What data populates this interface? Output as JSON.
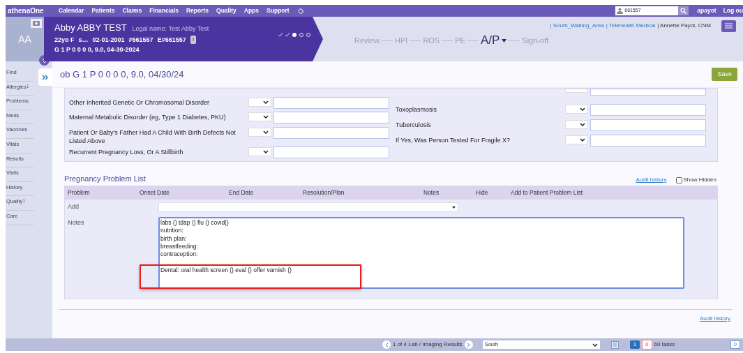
{
  "nav": {
    "brand": "athenaOne",
    "items": [
      "Calendar",
      "Patients",
      "Claims",
      "Financials",
      "Reports",
      "Quality",
      "Apps",
      "Support"
    ],
    "search_value": "661557",
    "user": "apayot",
    "logout": "Log ou"
  },
  "patient": {
    "initials": "AA",
    "name": "Abby ABBY TEST",
    "legal_name": "Legal name: Test Abby Test",
    "details": [
      "22yo F",
      "s…",
      "02-01-2001",
      "#661557",
      "E#661557"
    ],
    "alert": "!",
    "ob_line": "G 1 P 0 0 0 0, 9.0, 04-30-2024",
    "steps": [
      {
        "kind": "done"
      },
      {
        "kind": "done"
      },
      {
        "kind": "current"
      },
      {
        "kind": "todo"
      },
      {
        "kind": "todo"
      }
    ]
  },
  "location": {
    "links": [
      "| South_Waiting_Area",
      "| Telehealth Medical"
    ],
    "provider": "| Annette Payot, CNM"
  },
  "workflow": [
    {
      "label": "Review",
      "selected": false
    },
    {
      "label": "HPI",
      "selected": false
    },
    {
      "label": "ROS",
      "selected": false
    },
    {
      "label": "PE",
      "selected": false
    },
    {
      "label": "A/P",
      "selected": true
    },
    {
      "label": "Sign-off",
      "selected": false
    }
  ],
  "sidebar": [
    {
      "label": "Find"
    },
    {
      "label": "Allergies",
      "badge": "1"
    },
    {
      "label": "Problems"
    },
    {
      "label": "Meds"
    },
    {
      "label": "Vaccines"
    },
    {
      "label": "Vitals"
    },
    {
      "label": "Results"
    },
    {
      "label": "Visits"
    },
    {
      "label": "History"
    },
    {
      "label": "Quality",
      "badge": "1"
    },
    {
      "label": "Care"
    }
  ],
  "page_title": "ob G 1 P 0 0 0 0, 9.0, 04/30/24",
  "save": "Save",
  "questions_left": [
    "Other Inherited Genetic Or Chromosomal Disorder",
    "Maternal Metabolic Disorder (eg, Type 1 Diabetes, PKU)",
    "Patient Or Baby's Father Had A Child With Birth Defects Not Listed Above",
    "Recurrent Pregnancy Loss, Or A Stillbirth"
  ],
  "questions_right": [
    "Toxoplasmosis",
    "Tuberculosis",
    "If Yes, Was Person Tested For Fragile X?"
  ],
  "problem_list": {
    "title": "Pregnancy Problem List",
    "audit": "Audit history",
    "show_hidden": {
      "label": "Show Hidden",
      "checked": false
    },
    "columns": [
      "Problem",
      "Onset Date",
      "End Date",
      "Resolution/Plan",
      "Notes",
      "Hide",
      "Add to Patient Problem List"
    ],
    "add_label": "Add",
    "notes_label": "Notes",
    "notes_value": "labs () tdap () flu () covid()\nnutrition:\nbirth plan:\nbreastfeeding:\ncontraception:\n\nDental: oral health screen () eval () offer varnish ()"
  },
  "footer_audit": "Audit history",
  "status_bar": {
    "results": "1 of 4 Lab / Imaging Results",
    "location": "South",
    "count_a": "1",
    "count_b": "0",
    "tasks": "60 tasks",
    "messages": "0"
  }
}
